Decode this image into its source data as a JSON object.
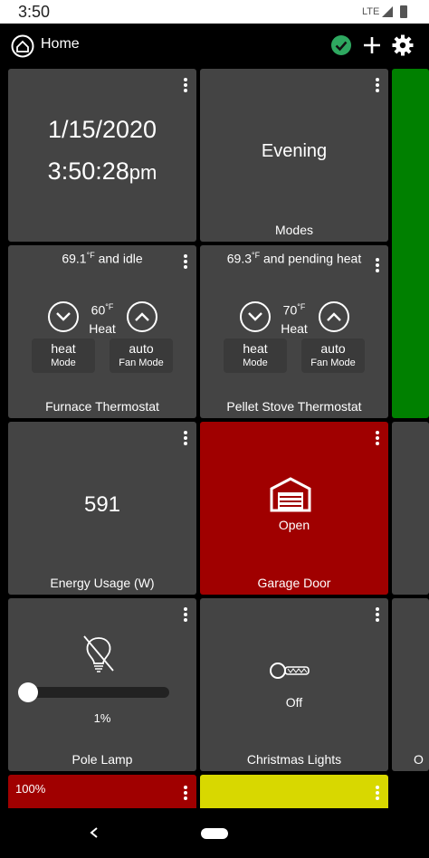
{
  "status": {
    "time": "3:50",
    "network": "LTE"
  },
  "header": {
    "title": "Home"
  },
  "tiles": {
    "clock": {
      "date": "1/15/2020",
      "time": "3:50:28",
      "ampm": "pm"
    },
    "modes": {
      "value": "Evening",
      "name": "Modes"
    },
    "furnace": {
      "current_temp": "69.1",
      "current_unit": "°F",
      "state": "and idle",
      "setpoint": "60",
      "setpoint_unit": "°F",
      "setpoint_label": "Heat",
      "mode_value": "heat",
      "mode_label": "Mode",
      "fan_value": "auto",
      "fan_label": "Fan Mode",
      "name": "Furnace Thermostat"
    },
    "pellet": {
      "current_temp": "69.3",
      "current_unit": "°F",
      "state": "and pending heat",
      "setpoint": "70",
      "setpoint_unit": "°F",
      "setpoint_label": "Heat",
      "mode_value": "heat",
      "mode_label": "Mode",
      "fan_value": "auto",
      "fan_label": "Fan Mode",
      "name": "Pellet Stove Thermostat"
    },
    "energy": {
      "value": "591",
      "name": "Energy Usage (W)"
    },
    "garage": {
      "state": "Open",
      "name": "Garage Door"
    },
    "pole_lamp": {
      "level": "1%",
      "level_fraction": 0.01,
      "name": "Pole Lamp"
    },
    "christmas": {
      "state": "Off",
      "name": "Christmas Lights"
    },
    "bottom_left": {
      "level": "100%"
    },
    "partial_o": {
      "text": "O"
    }
  },
  "colors": {
    "tile": "#444444",
    "green": "#008000",
    "red": "#a00000",
    "yellow": "#d8d800",
    "ok_check": "#2ea860"
  },
  "icons": [
    "home-icon",
    "check-circle-icon",
    "plus-icon",
    "gear-icon",
    "more-vert-icon",
    "chevron-down-icon",
    "chevron-up-icon",
    "garage-icon",
    "bulb-off-icon",
    "light-strip-icon",
    "back-icon"
  ]
}
